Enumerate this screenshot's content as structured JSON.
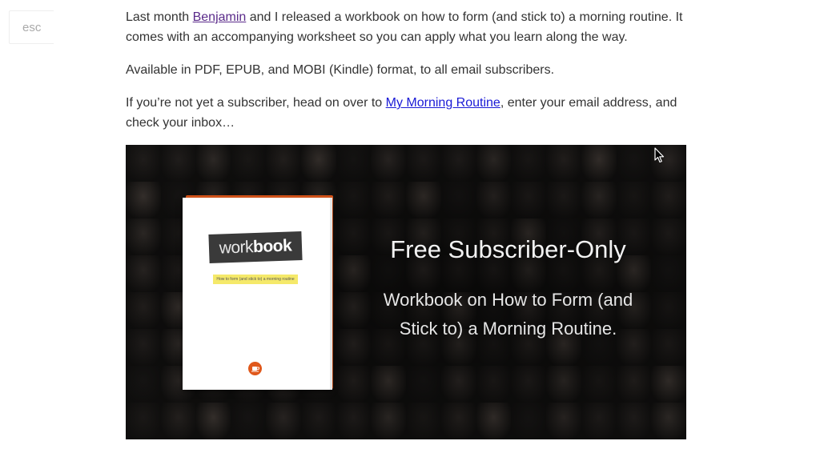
{
  "esc_button": {
    "label": "esc"
  },
  "article": {
    "p1": {
      "before": "Last month ",
      "link": "Benjamin",
      "after": " and I released a workbook on how to form (and stick to) a morning routine. It comes with an accompanying worksheet so you can apply what you learn along the way."
    },
    "p2": "Available in PDF, EPUB, and MOBI (Kindle) format, to all email subscribers.",
    "p3": {
      "before": "If you’re not yet a subscriber, head on over to ",
      "link": "My Morning Routine",
      "after": ", enter your email address, and check your inbox…"
    }
  },
  "promo": {
    "book_title_light": "work",
    "book_title_bold": "book",
    "book_subtitle": "How to form (and stick to) a morning routine",
    "heading": "Free Subscriber-Only",
    "text": "Workbook on How to Form (and Stick to) a Morning Routine."
  },
  "colors": {
    "visited_link": "#5a2a8a",
    "link": "#1a1ad6",
    "brand_orange": "#e0581b",
    "highlight_yellow": "#f5e96a"
  }
}
